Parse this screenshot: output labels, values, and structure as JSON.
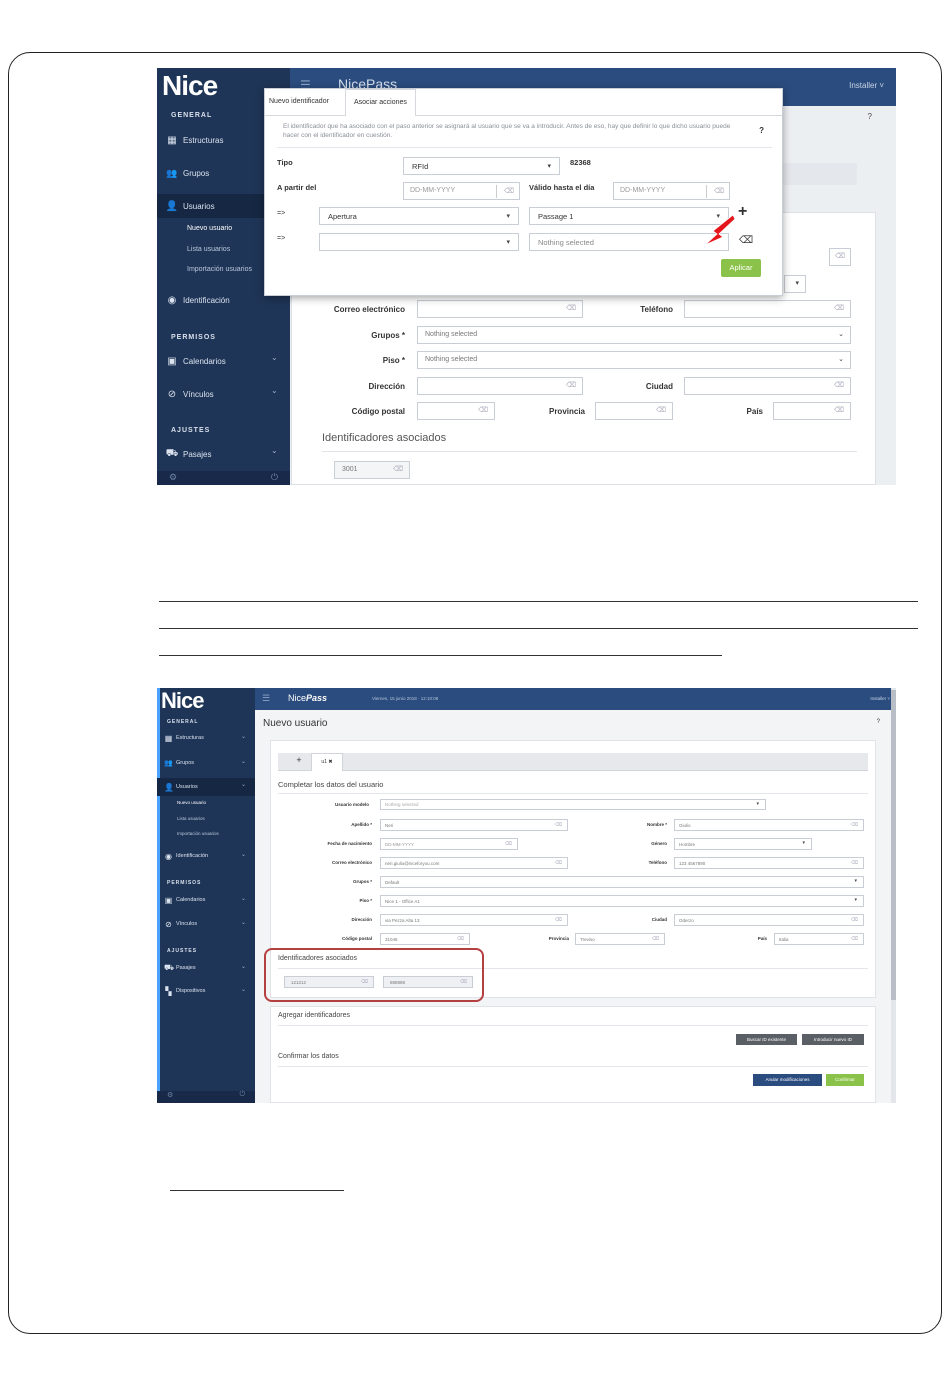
{
  "shot1": {
    "logo": "Nice",
    "app_title": "NicePass",
    "user_menu": "Installer ˅",
    "help": "?",
    "sidebar": {
      "general": "GENERAL",
      "estructuras": "Estructuras",
      "grupos": "Grupos",
      "usuarios": "Usuarios",
      "nuevo_usuario": "Nuevo usuario",
      "lista_usuarios": "Lista usuarios",
      "importacion": "Importación usuarios",
      "identificacion": "Identificación",
      "permisos": "PERMISOS",
      "calendarios": "Calendarios",
      "vinculos": "Vínculos",
      "ajustes": "AJUSTES",
      "pasajes": "Pasajes"
    },
    "modal": {
      "tab_new": "Nuevo identificador",
      "tab_assoc": "Asociar acciones",
      "info": "El identificador que ha asociado con el paso anterior se asignará al usuario que se va a introducir. Antes de eso, hay que definir lo que dicho usuario puede hacer con el identificador en cuestión.",
      "help": "?",
      "tipo_label": "Tipo",
      "tipo_value": "RFId",
      "code": "82368",
      "from_label": "A partir del",
      "date_placeholder": "DD-MM-YYYY",
      "valid_label": "Válido hasta el día",
      "arrow": "=>",
      "action1": "Apertura",
      "passage1": "Passage 1",
      "passage2": "Nothing selected",
      "plus": "+",
      "apply": "Aplicar"
    },
    "form": {
      "email": "Correo electrónico",
      "phone": "Teléfono",
      "grupos": "Grupos *",
      "grupos_val": "Nothing selected",
      "piso": "Piso *",
      "piso_val": "Nothing selected",
      "direccion": "Dirección",
      "ciudad": "Ciudad",
      "cp": "Código postal",
      "provincia": "Provincia",
      "pais": "País",
      "ids_heading": "Identificadores asociados",
      "id1": "3001"
    }
  },
  "shot2": {
    "logo": "Nice",
    "app_title_a": "Nice",
    "app_title_b": "Pass",
    "datetime": "Viernes, 15 junio 2018 · 12:10:08",
    "user_menu": "Installer ˅",
    "help": "?",
    "page_title": "Nuevo usuario",
    "sidebar": {
      "general": "GENERAL",
      "estructuras": "Estructuras",
      "grupos": "Grupos",
      "usuarios": "Usuarios",
      "nuevo_usuario": "Nuevo usuario",
      "lista_usuarios": "Lista usuarios",
      "importacion": "Importación usuarios",
      "identificacion": "Identificación",
      "permisos": "PERMISOS",
      "calendarios": "Calendarios",
      "vinculos": "Vínculos",
      "ajustes": "AJUSTES",
      "pasajes": "Pasajes",
      "dispositivos": "Dispositivos"
    },
    "tabs": {
      "plus": "+",
      "u1": "u1 ✖"
    },
    "section_title": "Completar los datos del usuario",
    "fields": {
      "usuario_modelo": "Usuario modelo",
      "usuario_modelo_val": "Nothing selected",
      "apellido": "Apellido *",
      "apellido_val": "Neri",
      "nombre": "Nombre *",
      "nombre_val": "Giulio",
      "fecha": "Fecha de nacimiento",
      "fecha_val": "DD-MM-YYYY",
      "genero": "Género",
      "genero_val": "Hombre",
      "email": "Correo electrónico",
      "email_val": "neri.giulio@niceforyou.com",
      "telefono": "Teléfono",
      "telefono_val": "123 4567890",
      "grupos": "Grupos *",
      "grupos_val": "Default",
      "piso": "Piso *",
      "piso_val": "Nice 1 - Office A1",
      "direccion": "Dirección",
      "direccion_val": "via Pezza Alta 13",
      "ciudad": "Ciudad",
      "ciudad_val": "Oderzo",
      "cp": "Código postal",
      "cp_val": "31046",
      "provincia": "Provincia",
      "provincia_val": "Treviso",
      "pais": "País",
      "pais_val": "Italia"
    },
    "ids_heading": "Identificadores asociados",
    "id1": "121212",
    "id2": "888888",
    "add_heading": "Agregar identificadores",
    "btn_search": "Buscar ID existente",
    "btn_new": "Introducir nuevo ID",
    "confirm_heading": "Confirmar los datos",
    "btn_cancel": "Anular modificaciones",
    "btn_confirm": "Confirmar"
  },
  "colors": {
    "sidebar": "#1f3557",
    "topbar": "#2b4c7e",
    "apply_green": "#8bc34a",
    "highlight_red": "#b4403f",
    "arrow_red": "#e5161b"
  }
}
